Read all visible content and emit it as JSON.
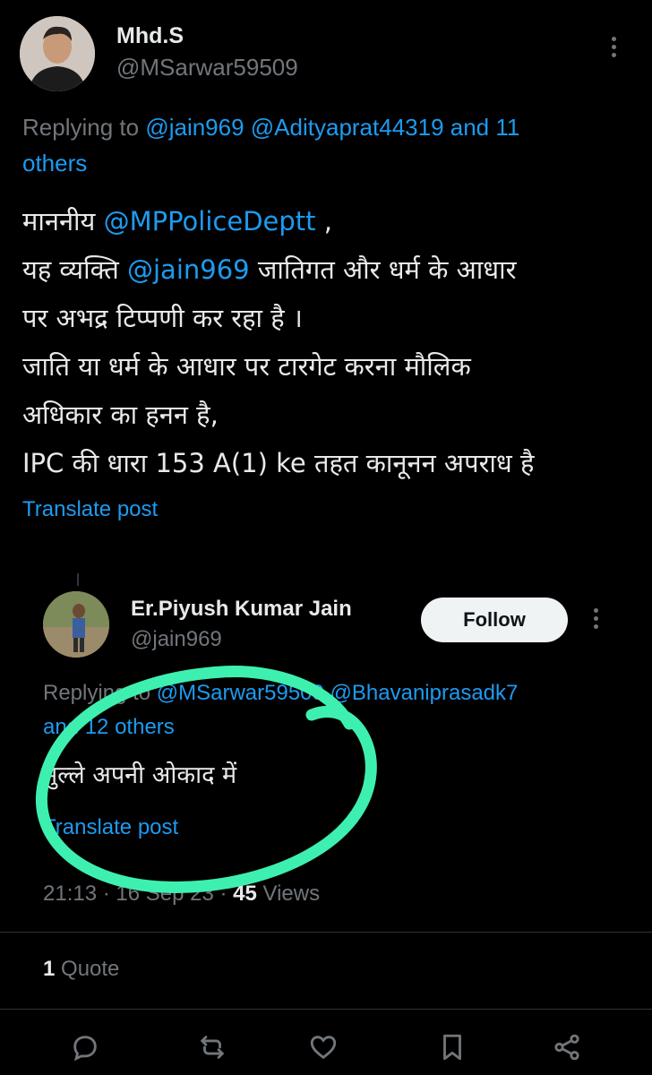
{
  "parent": {
    "name": "Mhd.S",
    "handle": "@MSarwar59509",
    "replying_prefix": "Replying to ",
    "replying_links": "@jain969 @Adityaprat44319 and 11",
    "replying_links_2": "others",
    "body_lines": [
      {
        "text_a": "माननीय ",
        "mention": "@MPPoliceDeptt",
        "text_b": " ,"
      },
      {
        "text_a": "यह व्यक्ति ",
        "mention": "@jain969",
        "text_b": " जातिगत और धर्म के आधार"
      },
      {
        "text_a": "पर अभद्र टिप्पणी कर रहा है ।"
      },
      {
        "text_a": "जाति या धर्म के आधार पर टारगेट करना मौलिक"
      },
      {
        "text_a": "अधिकार का हनन है,"
      },
      {
        "text_a": "IPC की धारा 153 A(1) ke तहत कानूनन अपराध है"
      }
    ],
    "translate": "Translate post"
  },
  "reply": {
    "name": "Er.Piyush Kumar Jain",
    "handle": "@jain969",
    "follow_label": "Follow",
    "replying_prefix": "Replying to ",
    "replying_links": "@MSarwar59509 @Bhavaniprasadk7",
    "replying_links_2": "and 12 others",
    "body": "मुल्ले अपनी ओकाद में",
    "translate": "Translate post",
    "time": "21:13 · 16 Sep 23 · ",
    "views_count": "45",
    "views_label": " Views",
    "quotes_count": "1",
    "quotes_label": " Quote"
  },
  "icons": {
    "more": "more-vertical-icon",
    "reply": "reply-icon",
    "repost": "repost-icon",
    "like": "heart-icon",
    "bookmark": "bookmark-icon",
    "share": "share-icon"
  },
  "colors": {
    "link": "#1d9bf0",
    "muted": "#71767b",
    "highlight_circle": "#3ef0b0"
  }
}
